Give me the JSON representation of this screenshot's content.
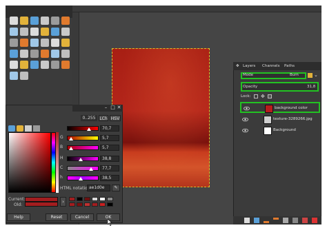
{
  "colors": {
    "accent_highlight": "#22c322",
    "foreground": "#a31d1f",
    "background": "#ffffff",
    "canvas_bg": "#454545"
  },
  "toolbox": {
    "tools": [
      "rect-select-icon",
      "ellipse-select-icon",
      "lasso-icon",
      "fuzzy-select-icon",
      "color-select-icon",
      "scissors-icon",
      "foreground-select-icon",
      "paths-icon",
      "move-icon",
      "align-icon",
      "crop-icon",
      "rotate-icon",
      "scale-icon",
      "shear-icon",
      "perspective-icon",
      "flip-icon",
      "text-icon",
      "cage-icon",
      "warp-icon",
      "bucket-fill-icon",
      "blend-icon",
      "pencil-icon",
      "paintbrush-icon",
      "eraser-icon",
      "airbrush-icon",
      "ink-icon",
      "clone-icon",
      "heal-icon",
      "smudge-icon",
      "blur-icon",
      "dodge-icon",
      "color-picker-icon"
    ]
  },
  "color_dialog": {
    "range_button": "0..255",
    "lch_button": "LCh",
    "hsv_button": "HSV",
    "sliders": [
      {
        "letter": "",
        "value": "70,7",
        "level": 0.71
      },
      {
        "letter": "G",
        "value": "5,7",
        "level": 0.06
      },
      {
        "letter": "B",
        "value": "5,7",
        "level": 0.06
      },
      {
        "letter": "H",
        "value": "38,8",
        "level": 0.39
      },
      {
        "letter": "C",
        "value": "77,7",
        "level": 0.78
      },
      {
        "letter": "h",
        "value": "38,5",
        "level": 0.39
      }
    ],
    "html_notation_label": "HTML notation:",
    "html_value": "ae1d0e",
    "current_label": "Current:",
    "old_label": "Old:",
    "buttons": {
      "help": "Help",
      "reset": "Reset",
      "cancel": "Cancel",
      "ok": "OK"
    }
  },
  "layers_panel": {
    "tabs": [
      "Layers",
      "Channels",
      "Paths"
    ],
    "mode_label": "Mode",
    "mode_value": "Burn",
    "opacity_label": "Opacity",
    "opacity_value": "31,8",
    "lock_label": "Lock:",
    "layers": [
      {
        "name": "background color",
        "thumb_color": "#b81c1c",
        "selected": true
      },
      {
        "name": "texture-3289266.jpg",
        "thumb_color": "#cfcfcf",
        "selected": false
      },
      {
        "name": "Background",
        "thumb_color": "#ffffff",
        "selected": false
      }
    ]
  }
}
